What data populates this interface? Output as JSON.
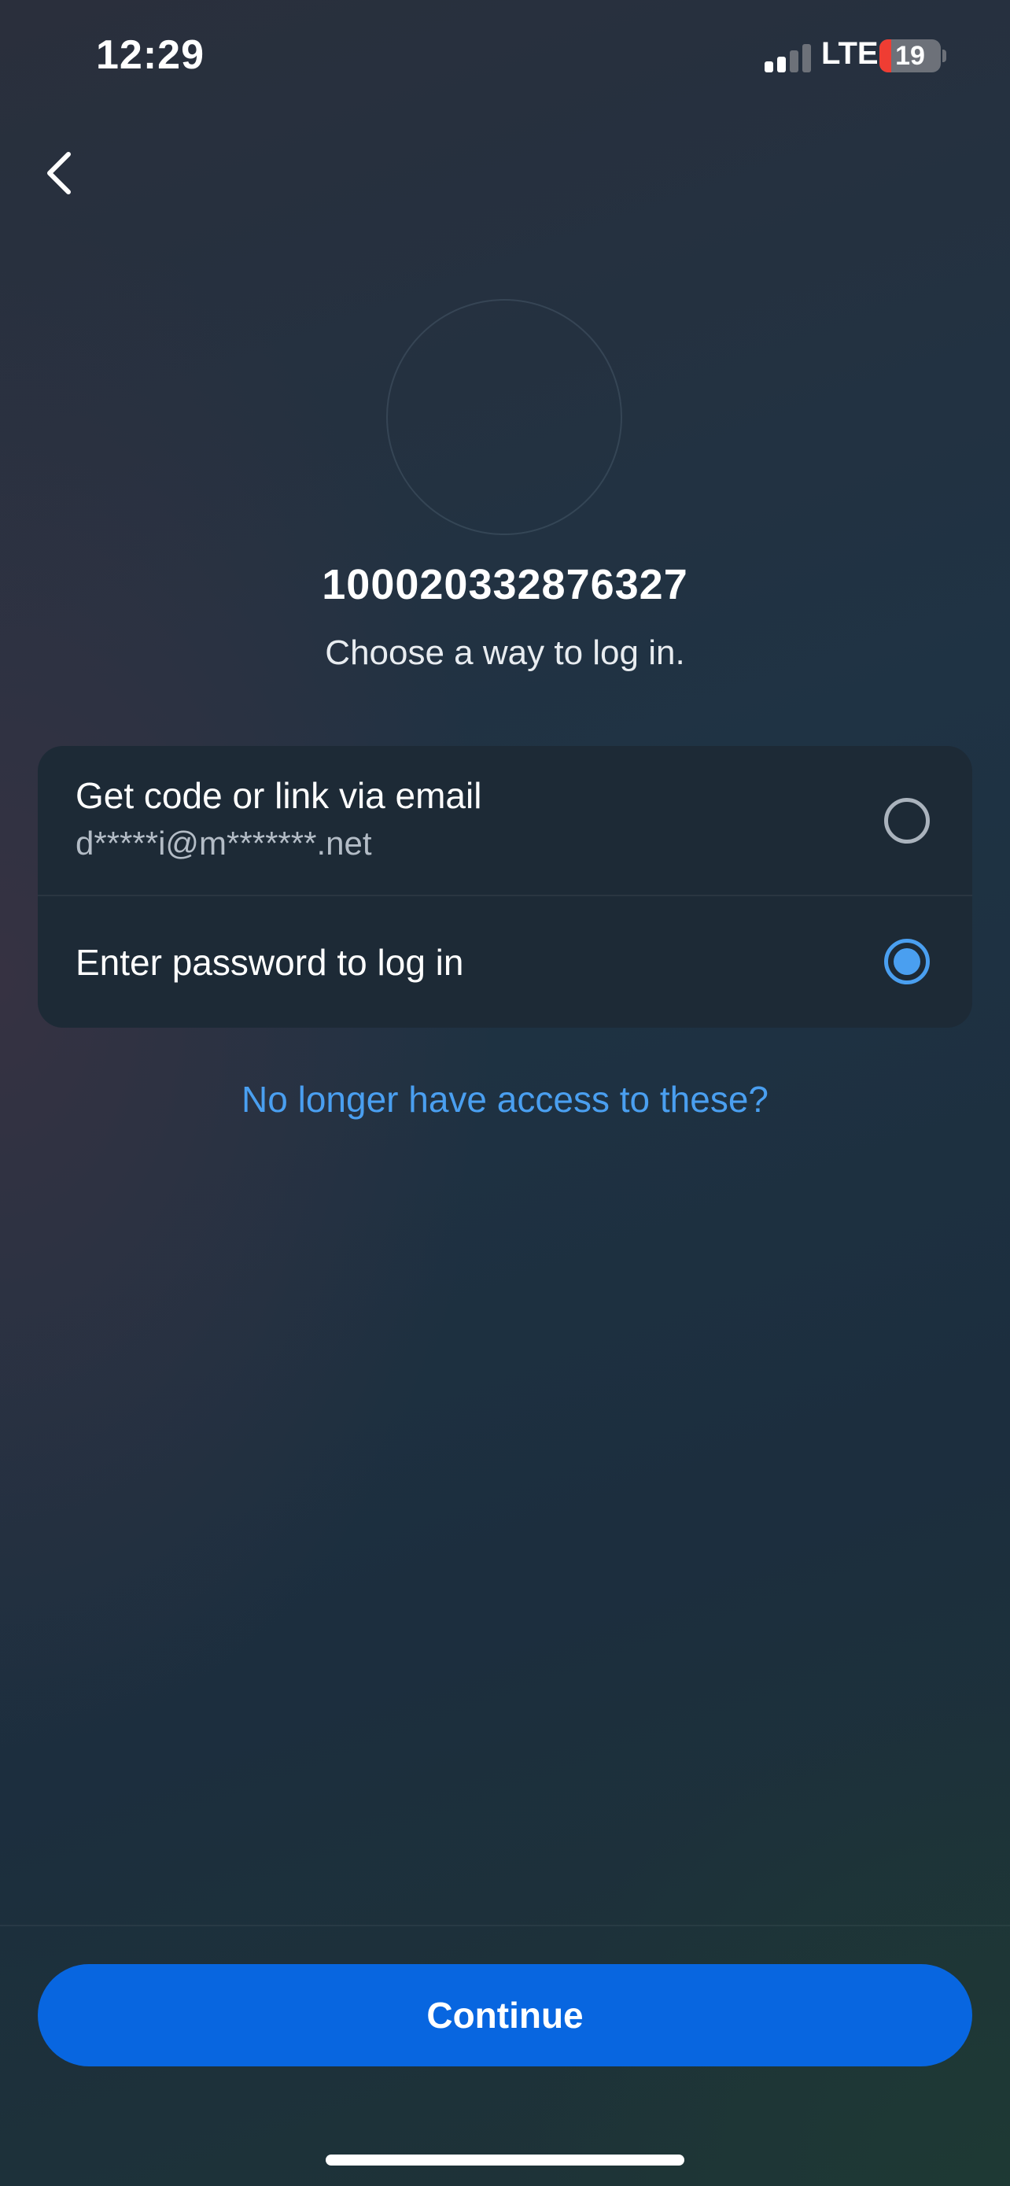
{
  "status_bar": {
    "time": "12:29",
    "network": "LTE",
    "battery_level": "19",
    "battery_fraction": 0.19,
    "battery_fill_color": "#ef3d33",
    "signal_bars_active": 2,
    "signal_bars_total": 4
  },
  "header": {
    "back_icon": "chevron-left-icon"
  },
  "account": {
    "identifier": "100020332876327",
    "prompt": "Choose a way to log in."
  },
  "options": [
    {
      "title": "Get code or link via email",
      "detail": "d*****i@m*******.net",
      "selected": false
    },
    {
      "title": "Enter password to log in",
      "selected": true
    }
  ],
  "links": {
    "no_access": "No longer have access to these?"
  },
  "footer": {
    "continue_label": "Continue"
  },
  "colors": {
    "accent": "#4a9ff0",
    "primary_button": "#0866e0",
    "card_background": "#1d2a36"
  }
}
